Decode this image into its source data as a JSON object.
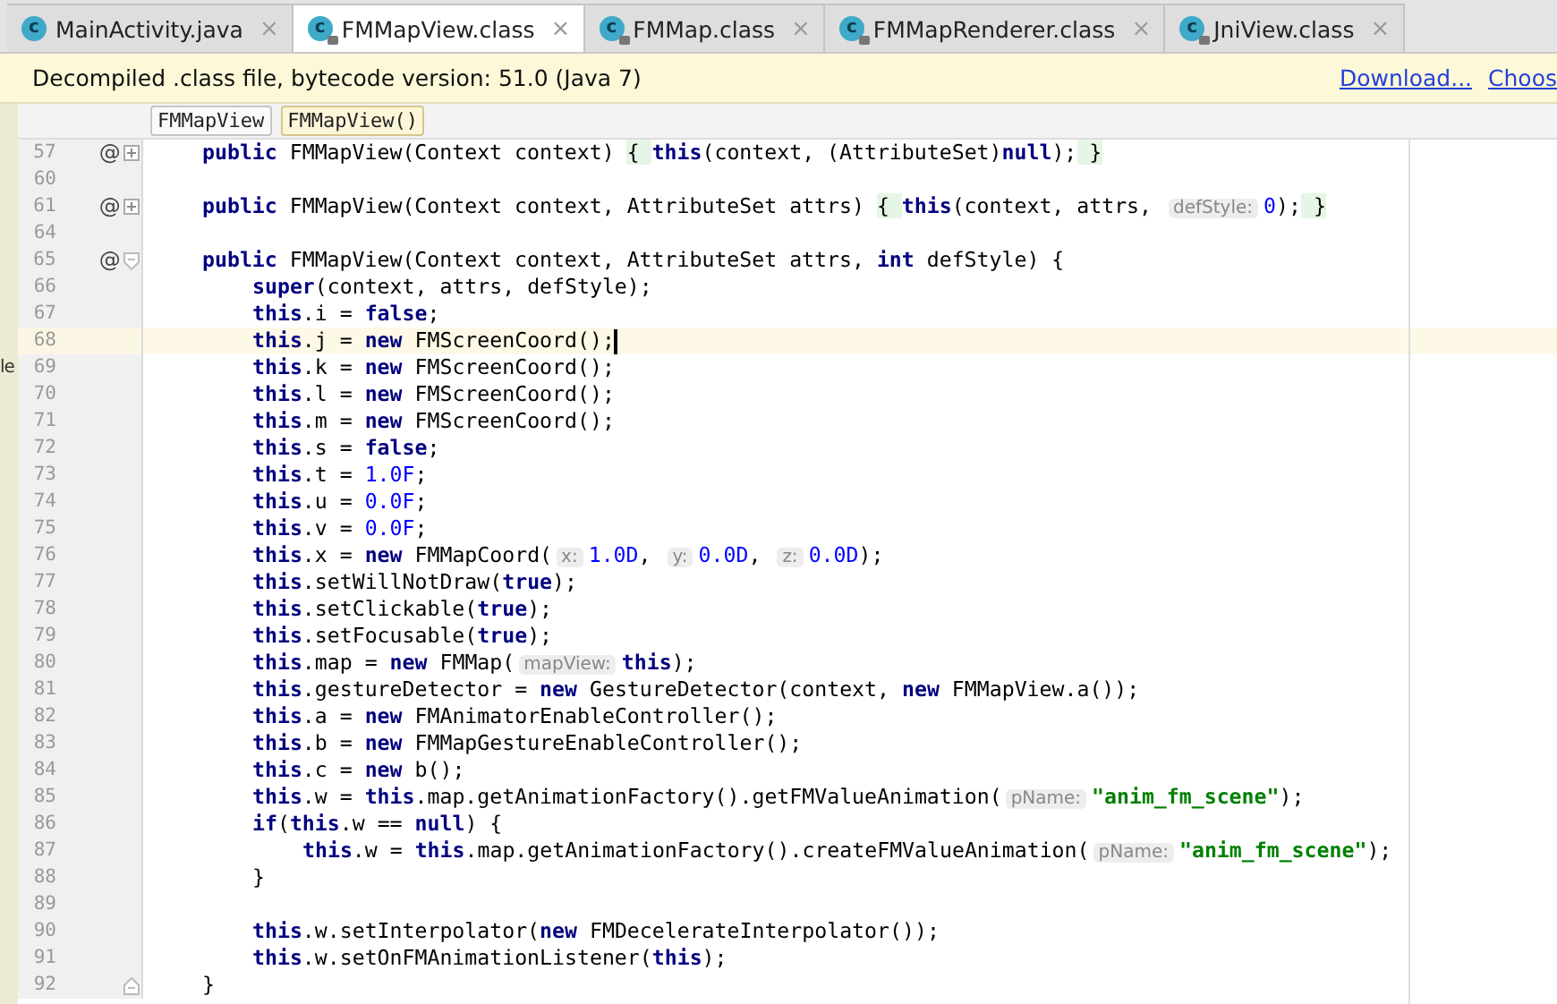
{
  "tabs": [
    {
      "icon": "c",
      "locked": false,
      "label": "MainActivity.java",
      "close": "×",
      "selected": false
    },
    {
      "icon": "c",
      "locked": true,
      "label": "FMMapView.class",
      "close": "×",
      "selected": true
    },
    {
      "icon": "c",
      "locked": true,
      "label": "FMMap.class",
      "close": "×",
      "selected": false
    },
    {
      "icon": "c",
      "locked": true,
      "label": "FMMapRenderer.class",
      "close": "×",
      "selected": false
    },
    {
      "icon": "c",
      "locked": true,
      "label": "JniView.class",
      "close": "×",
      "selected": false
    }
  ],
  "notice": {
    "text": "Decompiled .class file, bytecode version: 51.0 (Java 7)",
    "links": [
      "Download...",
      "Choos"
    ]
  },
  "breadcrumbs": [
    {
      "label": "FMMapView",
      "selected": false
    },
    {
      "label": "FMMapView()",
      "selected": true
    }
  ],
  "side_panel_text": "le",
  "editor": {
    "lines": [
      {
        "number": "57",
        "marker": "@",
        "fold_icon": {
          "kind": "expand"
        },
        "current": false,
        "caret": false,
        "tokens": [
          {
            "kind": "kw",
            "text": "public"
          },
          {
            "kind": "plain",
            "text": " FMMapView(Context context) "
          },
          {
            "kind": "fold",
            "text": "{ "
          },
          {
            "kind": "kw",
            "text": "this"
          },
          {
            "kind": "plain",
            "text": "(context, (AttributeSet)"
          },
          {
            "kind": "kw",
            "text": "null"
          },
          {
            "kind": "plain",
            "text": ");"
          },
          {
            "kind": "fold",
            "text": " }"
          }
        ]
      },
      {
        "number": "60",
        "current": false,
        "caret": false
      },
      {
        "number": "61",
        "marker": "@",
        "fold_icon": {
          "kind": "expand"
        },
        "current": false,
        "caret": false,
        "tokens": [
          {
            "kind": "kw",
            "text": "public"
          },
          {
            "kind": "plain",
            "text": " FMMapView(Context context, AttributeSet attrs) "
          },
          {
            "kind": "fold",
            "text": "{ "
          },
          {
            "kind": "kw",
            "text": "this"
          },
          {
            "kind": "plain",
            "text": "(context, attrs, "
          },
          {
            "kind": "hint",
            "text": "defStyle:"
          },
          {
            "kind": "num",
            "text": "0"
          },
          {
            "kind": "plain",
            "text": ");"
          },
          {
            "kind": "fold",
            "text": " }"
          }
        ]
      },
      {
        "number": "64",
        "current": false,
        "caret": false
      },
      {
        "number": "65",
        "marker": "@",
        "fold_icon": {
          "kind": "collapse"
        },
        "current": false,
        "caret": false,
        "tokens": [
          {
            "kind": "kw",
            "text": "public"
          },
          {
            "kind": "plain",
            "text": " FMMapView(Context context, AttributeSet attrs, "
          },
          {
            "kind": "kw",
            "text": "int"
          },
          {
            "kind": "plain",
            "text": " defStyle) {"
          }
        ],
        "children": [
          {
            "number": "66",
            "current": false,
            "caret": false,
            "tokens": [
              {
                "kind": "kw",
                "text": "super"
              },
              {
                "kind": "plain",
                "text": "(context, attrs, defStyle);"
              }
            ]
          },
          {
            "number": "67",
            "current": false,
            "caret": false,
            "tokens": [
              {
                "kind": "kw",
                "text": "this"
              },
              {
                "kind": "plain",
                "text": ".i = "
              },
              {
                "kind": "kw",
                "text": "false"
              },
              {
                "kind": "plain",
                "text": ";"
              }
            ]
          },
          {
            "number": "68",
            "current": true,
            "caret": true,
            "tokens": [
              {
                "kind": "kw",
                "text": "this"
              },
              {
                "kind": "plain",
                "text": ".j = "
              },
              {
                "kind": "kw",
                "text": "new"
              },
              {
                "kind": "plain",
                "text": " FMScreenCoord();"
              }
            ]
          },
          {
            "number": "69",
            "current": false,
            "caret": false,
            "tokens": [
              {
                "kind": "kw",
                "text": "this"
              },
              {
                "kind": "plain",
                "text": ".k = "
              },
              {
                "kind": "kw",
                "text": "new"
              },
              {
                "kind": "plain",
                "text": " FMScreenCoord();"
              }
            ]
          },
          {
            "number": "70",
            "current": false,
            "caret": false,
            "tokens": [
              {
                "kind": "kw",
                "text": "this"
              },
              {
                "kind": "plain",
                "text": ".l = "
              },
              {
                "kind": "kw",
                "text": "new"
              },
              {
                "kind": "plain",
                "text": " FMScreenCoord();"
              }
            ]
          },
          {
            "number": "71",
            "current": false,
            "caret": false,
            "tokens": [
              {
                "kind": "kw",
                "text": "this"
              },
              {
                "kind": "plain",
                "text": ".m = "
              },
              {
                "kind": "kw",
                "text": "new"
              },
              {
                "kind": "plain",
                "text": " FMScreenCoord();"
              }
            ]
          },
          {
            "number": "72",
            "current": false,
            "caret": false,
            "tokens": [
              {
                "kind": "kw",
                "text": "this"
              },
              {
                "kind": "plain",
                "text": ".s = "
              },
              {
                "kind": "kw",
                "text": "false"
              },
              {
                "kind": "plain",
                "text": ";"
              }
            ]
          },
          {
            "number": "73",
            "current": false,
            "caret": false,
            "tokens": [
              {
                "kind": "kw",
                "text": "this"
              },
              {
                "kind": "plain",
                "text": ".t = "
              },
              {
                "kind": "num",
                "text": "1.0F"
              },
              {
                "kind": "plain",
                "text": ";"
              }
            ]
          },
          {
            "number": "74",
            "current": false,
            "caret": false,
            "tokens": [
              {
                "kind": "kw",
                "text": "this"
              },
              {
                "kind": "plain",
                "text": ".u = "
              },
              {
                "kind": "num",
                "text": "0.0F"
              },
              {
                "kind": "plain",
                "text": ";"
              }
            ]
          },
          {
            "number": "75",
            "current": false,
            "caret": false,
            "tokens": [
              {
                "kind": "kw",
                "text": "this"
              },
              {
                "kind": "plain",
                "text": ".v = "
              },
              {
                "kind": "num",
                "text": "0.0F"
              },
              {
                "kind": "plain",
                "text": ";"
              }
            ]
          },
          {
            "number": "76",
            "current": false,
            "caret": false,
            "tokens": [
              {
                "kind": "kw",
                "text": "this"
              },
              {
                "kind": "plain",
                "text": ".x = "
              },
              {
                "kind": "kw",
                "text": "new"
              },
              {
                "kind": "plain",
                "text": " FMMapCoord("
              },
              {
                "kind": "hint",
                "text": "x:"
              },
              {
                "kind": "num",
                "text": "1.0D"
              },
              {
                "kind": "plain",
                "text": ", "
              },
              {
                "kind": "hint",
                "text": "y:"
              },
              {
                "kind": "num",
                "text": "0.0D"
              },
              {
                "kind": "plain",
                "text": ", "
              },
              {
                "kind": "hint",
                "text": "z:"
              },
              {
                "kind": "num",
                "text": "0.0D"
              },
              {
                "kind": "plain",
                "text": ");"
              }
            ]
          },
          {
            "number": "77",
            "current": false,
            "caret": false,
            "tokens": [
              {
                "kind": "kw",
                "text": "this"
              },
              {
                "kind": "plain",
                "text": ".setWillNotDraw("
              },
              {
                "kind": "kw",
                "text": "true"
              },
              {
                "kind": "plain",
                "text": ");"
              }
            ]
          },
          {
            "number": "78",
            "current": false,
            "caret": false,
            "tokens": [
              {
                "kind": "kw",
                "text": "this"
              },
              {
                "kind": "plain",
                "text": ".setClickable("
              },
              {
                "kind": "kw",
                "text": "true"
              },
              {
                "kind": "plain",
                "text": ");"
              }
            ]
          },
          {
            "number": "79",
            "current": false,
            "caret": false,
            "tokens": [
              {
                "kind": "kw",
                "text": "this"
              },
              {
                "kind": "plain",
                "text": ".setFocusable("
              },
              {
                "kind": "kw",
                "text": "true"
              },
              {
                "kind": "plain",
                "text": ");"
              }
            ]
          },
          {
            "number": "80",
            "current": false,
            "caret": false,
            "tokens": [
              {
                "kind": "kw",
                "text": "this"
              },
              {
                "kind": "plain",
                "text": ".map = "
              },
              {
                "kind": "kw",
                "text": "new"
              },
              {
                "kind": "plain",
                "text": " FMMap("
              },
              {
                "kind": "hint",
                "text": "mapView:"
              },
              {
                "kind": "kw",
                "text": "this"
              },
              {
                "kind": "plain",
                "text": ");"
              }
            ]
          },
          {
            "number": "81",
            "current": false,
            "caret": false,
            "tokens": [
              {
                "kind": "kw",
                "text": "this"
              },
              {
                "kind": "plain",
                "text": ".gestureDetector = "
              },
              {
                "kind": "kw",
                "text": "new"
              },
              {
                "kind": "plain",
                "text": " GestureDetector(context, "
              },
              {
                "kind": "kw",
                "text": "new"
              },
              {
                "kind": "plain",
                "text": " FMMapView.a());"
              }
            ]
          },
          {
            "number": "82",
            "current": false,
            "caret": false,
            "tokens": [
              {
                "kind": "kw",
                "text": "this"
              },
              {
                "kind": "plain",
                "text": ".a = "
              },
              {
                "kind": "kw",
                "text": "new"
              },
              {
                "kind": "plain",
                "text": " FMAnimatorEnableController();"
              }
            ]
          },
          {
            "number": "83",
            "current": false,
            "caret": false,
            "tokens": [
              {
                "kind": "kw",
                "text": "this"
              },
              {
                "kind": "plain",
                "text": ".b = "
              },
              {
                "kind": "kw",
                "text": "new"
              },
              {
                "kind": "plain",
                "text": " FMMapGestureEnableController();"
              }
            ]
          },
          {
            "number": "84",
            "current": false,
            "caret": false,
            "tokens": [
              {
                "kind": "kw",
                "text": "this"
              },
              {
                "kind": "plain",
                "text": ".c = "
              },
              {
                "kind": "kw",
                "text": "new"
              },
              {
                "kind": "plain",
                "text": " b();"
              }
            ]
          },
          {
            "number": "85",
            "current": false,
            "caret": false,
            "tokens": [
              {
                "kind": "kw",
                "text": "this"
              },
              {
                "kind": "plain",
                "text": ".w = "
              },
              {
                "kind": "kw",
                "text": "this"
              },
              {
                "kind": "plain",
                "text": ".map.getAnimationFactory().getFMValueAnimation("
              },
              {
                "kind": "hint",
                "text": "pName:"
              },
              {
                "kind": "str",
                "text": "\"anim_fm_scene\""
              },
              {
                "kind": "plain",
                "text": ");"
              }
            ]
          },
          {
            "number": "86",
            "current": false,
            "caret": false,
            "tokens": [
              {
                "kind": "kw",
                "text": "if"
              },
              {
                "kind": "plain",
                "text": "("
              },
              {
                "kind": "kw",
                "text": "this"
              },
              {
                "kind": "plain",
                "text": ".w == "
              },
              {
                "kind": "kw",
                "text": "null"
              },
              {
                "kind": "plain",
                "text": ") {"
              }
            ],
            "children": [
              {
                "number": "87",
                "current": false,
                "caret": false,
                "tokens": [
                  {
                    "kind": "kw",
                    "text": "this"
                  },
                  {
                    "kind": "plain",
                    "text": ".w = "
                  },
                  {
                    "kind": "kw",
                    "text": "this"
                  },
                  {
                    "kind": "plain",
                    "text": ".map.getAnimationFactory().createFMValueAnimation("
                  },
                  {
                    "kind": "hint",
                    "text": "pName:"
                  },
                  {
                    "kind": "str",
                    "text": "\"anim_fm_scene\""
                  },
                  {
                    "kind": "plain",
                    "text": ");"
                  }
                ]
              }
            ]
          },
          {
            "number": "88",
            "current": false,
            "caret": false,
            "tokens": [
              {
                "kind": "plain",
                "text": "}"
              }
            ]
          },
          {
            "number": "89",
            "current": false,
            "caret": false
          },
          {
            "number": "90",
            "current": false,
            "caret": false,
            "tokens": [
              {
                "kind": "kw",
                "text": "this"
              },
              {
                "kind": "plain",
                "text": ".w.setInterpolator("
              },
              {
                "kind": "kw",
                "text": "new"
              },
              {
                "kind": "plain",
                "text": " FMDecelerateInterpolator());"
              }
            ]
          },
          {
            "number": "91",
            "current": false,
            "caret": false,
            "tokens": [
              {
                "kind": "kw",
                "text": "this"
              },
              {
                "kind": "plain",
                "text": ".w.setOnFMAnimationListener("
              },
              {
                "kind": "kw",
                "text": "this"
              },
              {
                "kind": "plain",
                "text": ");"
              }
            ]
          }
        ]
      },
      {
        "number": "92",
        "fold_icon": {
          "kind": "collapse-end"
        },
        "current": false,
        "caret": false,
        "tokens": [
          {
            "kind": "plain",
            "text": "}"
          }
        ]
      }
    ]
  }
}
